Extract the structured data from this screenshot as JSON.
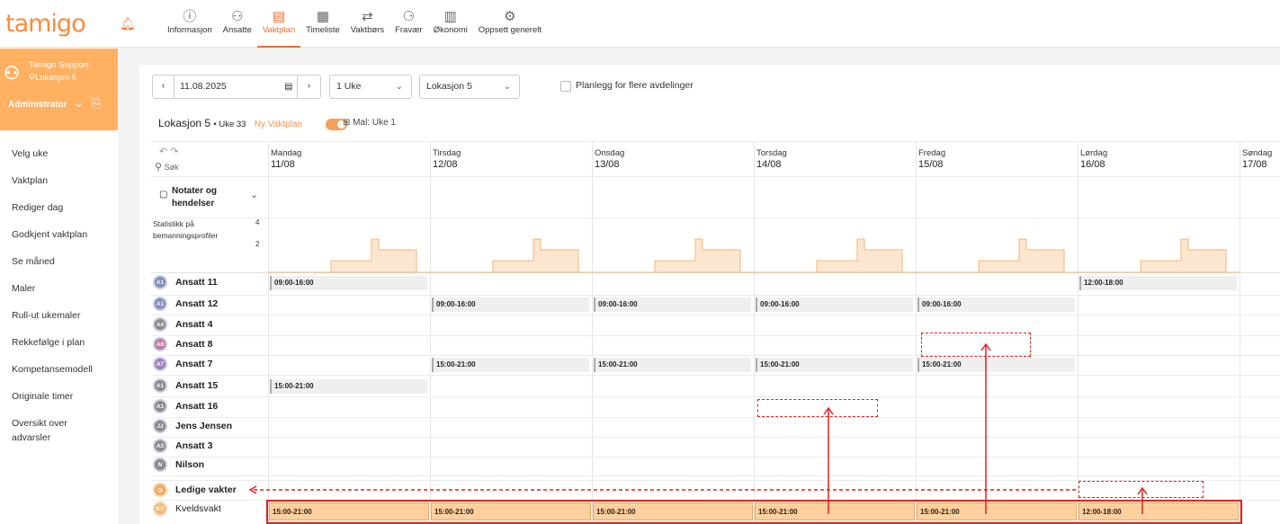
{
  "app": {
    "logo": "tamigo"
  },
  "nav": [
    {
      "label": "Informasjon",
      "icon": "info-icon",
      "glyph": "ⓘ"
    },
    {
      "label": "Ansatte",
      "icon": "people-icon",
      "glyph": "⚇"
    },
    {
      "label": "Vaktplan",
      "icon": "schedule-icon",
      "glyph": "▤"
    },
    {
      "label": "Timeliste",
      "icon": "timesheet-icon",
      "glyph": "▦"
    },
    {
      "label": "Vaktbørs",
      "icon": "swap-icon",
      "glyph": "⇄"
    },
    {
      "label": "Fravær",
      "icon": "absence-icon",
      "glyph": "⚆"
    },
    {
      "label": "Økonomi",
      "icon": "economy-icon",
      "glyph": "▥"
    },
    {
      "label": "Oppsett generelt",
      "icon": "settings-icon",
      "glyph": "⚙"
    }
  ],
  "user": {
    "name": "Tamigo Support",
    "location": "Lokasjon 5",
    "role": "Administrator"
  },
  "menu": [
    "Velg uke",
    "Vaktplan",
    "Rediger dag",
    "Godkjent vaktplan",
    "Se måned",
    "Maler",
    "Rull-ut ukemaler",
    "Rekkefølge i plan",
    "Kompetansemodell",
    "Originale timer",
    "Oversikt over advarsler"
  ],
  "toolbar": {
    "date": "11.08.2025",
    "period": "1 Uke",
    "location": "Lokasjon 5",
    "plan_multi": "Planlegg for flere avdelinger"
  },
  "header": {
    "location": "Lokasjon 5",
    "week": "• Uke 33",
    "new_plan": "Ny Vaktplan",
    "template": "Mal: Uke 1"
  },
  "grid": {
    "search_placeholder": "Søk",
    "notes_label": "Notater og hendelser",
    "stats_label": "Statistikk på bemanningsprofiler",
    "stats_max": "4",
    "stats_mid": "2",
    "days": [
      {
        "name": "Mandag",
        "date": "11/08"
      },
      {
        "name": "Tirsdag",
        "date": "12/08"
      },
      {
        "name": "Onsdag",
        "date": "13/08"
      },
      {
        "name": "Torsdag",
        "date": "14/08"
      },
      {
        "name": "Fredag",
        "date": "15/08"
      },
      {
        "name": "Lørdag",
        "date": "16/08"
      },
      {
        "name": "Søndag",
        "date": "17/08"
      }
    ],
    "employees": [
      {
        "initials": "A1",
        "name": "Ansatt 11",
        "color": "#7f8fb8",
        "shifts": [
          "09:00-16:00",
          "",
          "",
          "",
          "",
          "12:00-18:00",
          ""
        ]
      },
      {
        "initials": "A1",
        "name": "Ansatt 12",
        "color": "#7f8fb8",
        "shifts": [
          "",
          "09:00-16:00",
          "09:00-16:00",
          "09:00-16:00",
          "09:00-16:00",
          "",
          ""
        ]
      },
      {
        "initials": "A4",
        "name": "Ansatt 4",
        "color": "#8a8a8a",
        "shifts": [
          "",
          "",
          "",
          "",
          "",
          "",
          ""
        ]
      },
      {
        "initials": "A8",
        "name": "Ansatt 8",
        "color": "#c07aa0",
        "shifts": [
          "",
          "",
          "",
          "",
          "",
          "",
          ""
        ]
      },
      {
        "initials": "A7",
        "name": "Ansatt 7",
        "color": "#a080b8",
        "shifts": [
          "",
          "15:00-21:00",
          "15:00-21:00",
          "15:00-21:00",
          "15:00-21:00",
          "",
          ""
        ]
      },
      {
        "initials": "A1",
        "name": "Ansatt 15",
        "color": "#8a8a8a",
        "shifts": [
          "15:00-21:00",
          "",
          "",
          "",
          "",
          "",
          ""
        ]
      },
      {
        "initials": "A1",
        "name": "Ansatt 16",
        "color": "#8a8a8a",
        "shifts": [
          "",
          "",
          "",
          "",
          "",
          "",
          ""
        ]
      },
      {
        "initials": "JJ",
        "name": "Jens Jensen",
        "color": "#8a8a8a",
        "shifts": [
          "",
          "",
          "",
          "",
          "",
          "",
          ""
        ]
      },
      {
        "initials": "A3",
        "name": "Ansatt 3",
        "color": "#8a8a8a",
        "shifts": [
          "",
          "",
          "",
          "",
          "",
          "",
          ""
        ]
      },
      {
        "initials": "N",
        "name": "Nilson",
        "color": "#8a8a8a",
        "shifts": [
          "",
          "",
          "",
          "",
          "",
          "",
          ""
        ]
      }
    ],
    "open_shifts": {
      "label": "Ledige vakter"
    },
    "evening": {
      "initials": "KV",
      "name": "Kveldsvakt",
      "shifts": [
        "15:00-21:00",
        "15:00-21:00",
        "15:00-21:00",
        "15:00-21:00",
        "15:00-21:00",
        "12:00-18:00"
      ]
    }
  }
}
